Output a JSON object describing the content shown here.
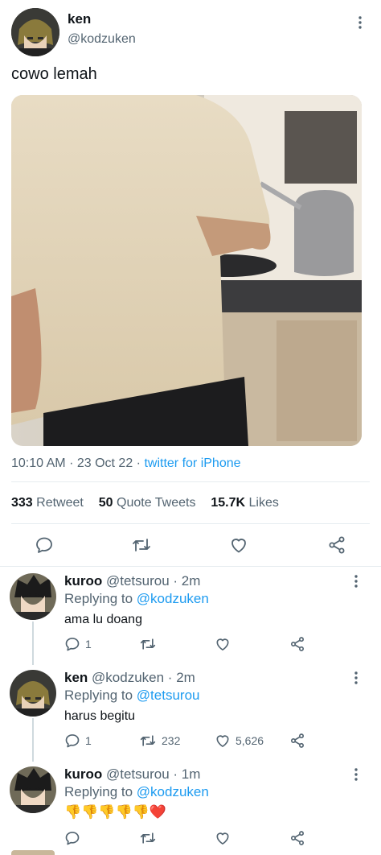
{
  "tweet": {
    "display_name": "ken",
    "handle": "@kodzuken",
    "text": "cowo lemah",
    "time": "10:10 AM",
    "date": "23 Oct 22",
    "source": "twitter for iPhone",
    "retweets": "333",
    "retweets_label": "Retweet",
    "quotes": "50",
    "quotes_label": "Quote Tweets",
    "likes": "15.7K",
    "likes_label": "Likes"
  },
  "replies": [
    {
      "display_name": "kuroo",
      "handle": "@tetsurou",
      "time": "2m",
      "replying_label": "Replying to",
      "replying_to": "@kodzuken",
      "text": "ama lu doang",
      "reply_count": "1",
      "retweet_count": "",
      "like_count": ""
    },
    {
      "display_name": "ken",
      "handle": "@kodzuken",
      "time": "2m",
      "replying_label": "Replying to",
      "replying_to": "@tetsurou",
      "text": "harus begitu",
      "reply_count": "1",
      "retweet_count": "232",
      "like_count": "5,626"
    },
    {
      "display_name": "kuroo",
      "handle": "@tetsurou",
      "time": "1m",
      "replying_label": "Replying to",
      "replying_to": "@kodzuken",
      "text": "👎👎👎👎👎❤️",
      "reply_count": "",
      "retweet_count": "",
      "like_count": ""
    }
  ],
  "colors": {
    "accent": "#1d9bf0",
    "text": "#0f1419",
    "muted": "#536471",
    "divider": "#e6ecf0"
  }
}
